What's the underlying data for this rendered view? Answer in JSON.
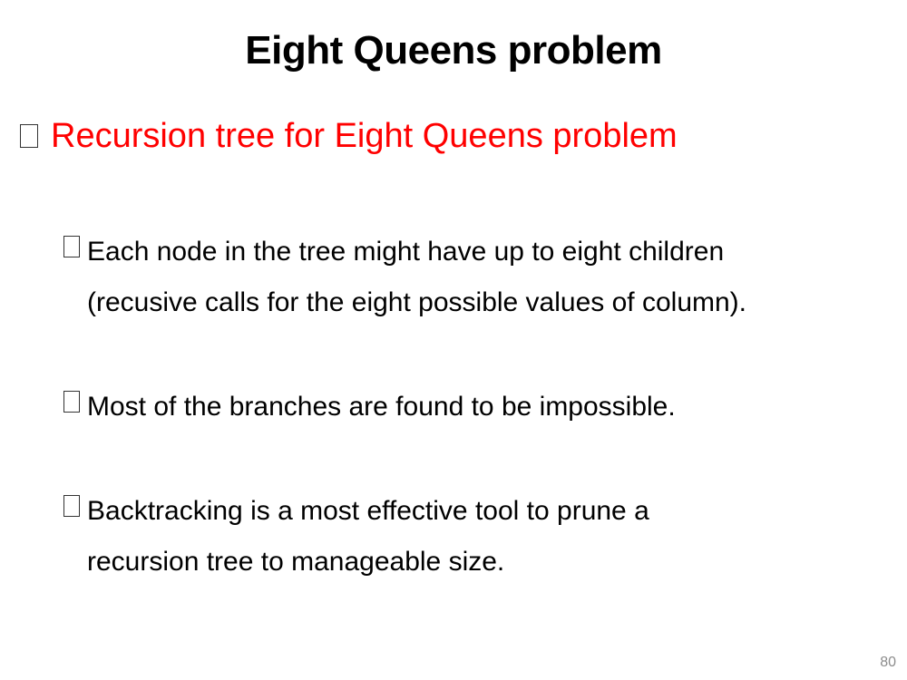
{
  "slide": {
    "title": "Eight Queens problem",
    "main_bullet": "Recursion tree for Eight Queens problem",
    "sub_bullets": [
      {
        "line1": "Each node in the tree might have up to eight children",
        "line2": "(recusive calls for the eight possible values of column)."
      },
      {
        "line1": "Most of the branches are found to be impossible."
      },
      {
        "line1": "Backtracking  is a most effective tool to prune a",
        "line2": "recursion tree to manageable size."
      }
    ],
    "page_number": "80"
  },
  "colors": {
    "main_bullet_text": "#ff0000",
    "body_text": "#000000",
    "page_number": "#8c8c8c"
  }
}
